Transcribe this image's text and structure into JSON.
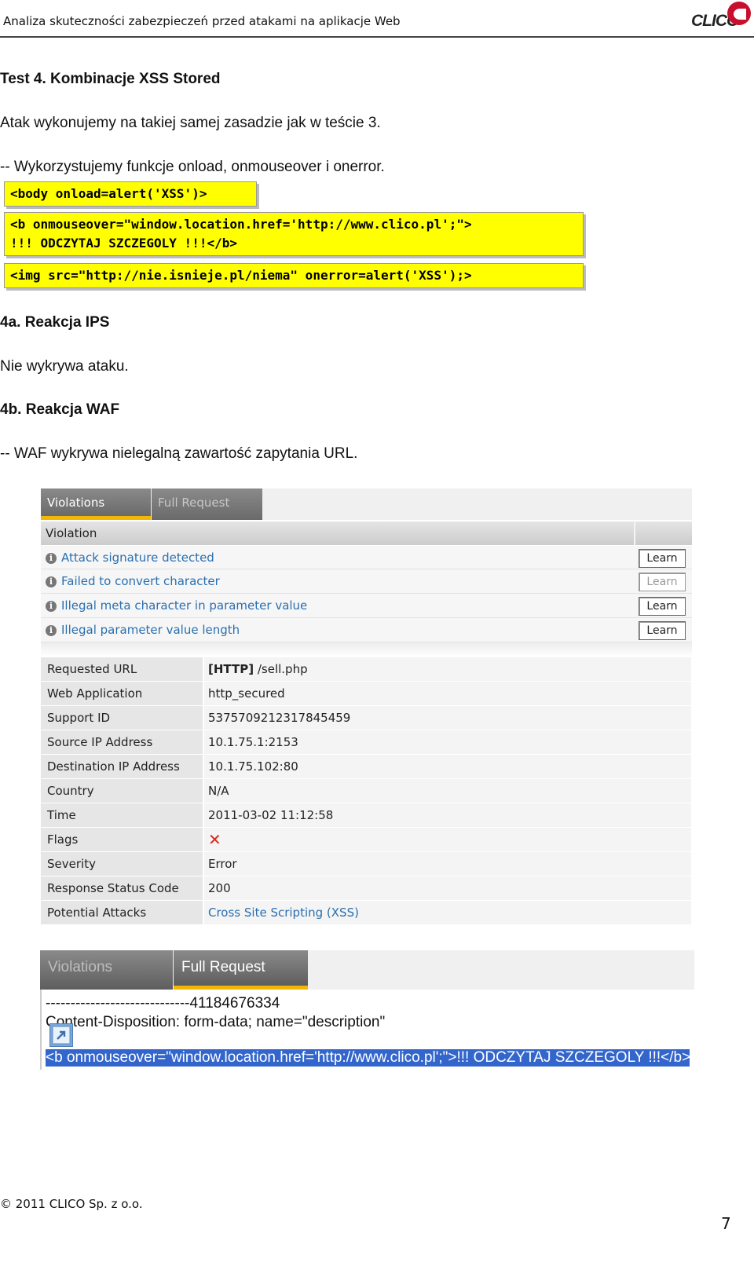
{
  "header": {
    "title": "Analiza skuteczności zabezpieczeń przed atakami na aplikacje Web",
    "logo_text": "CLICO"
  },
  "body": {
    "heading": "Test 4. Kombinacje XSS Stored",
    "para1": "Atak wykonujemy na takiej samej zasadzie jak w teście 3.",
    "para2": "-- Wykorzystujemy funkcje onload, onmouseover i onerror.",
    "code1": "<body onload=alert('XSS')>",
    "code2_line1": "<b onmouseover=\"window.location.href='http://www.clico.pl';\">",
    "code2_line2": "!!! ODCZYTAJ SZCZEGOLY !!!</b>",
    "code3": "<img src=\"http://nie.isnieje.pl/niema\" onerror=alert('XSS');>",
    "h_ips": "4a. Reakcja IPS",
    "ips_text": "Nie wykrywa ataku.",
    "h_waf": "4b. Reakcja WAF",
    "waf_text": "-- WAF wykrywa nielegalną zawartość zapytania URL."
  },
  "panel1": {
    "tabs": [
      "Violations",
      "Full Request"
    ],
    "violation_header": "Violation",
    "violations": [
      {
        "text": "Attack signature detected",
        "learn": "Learn",
        "enabled": true
      },
      {
        "text": "Failed to convert character",
        "learn": "Learn",
        "enabled": false
      },
      {
        "text": "Illegal meta character in parameter value",
        "learn": "Learn",
        "enabled": true
      },
      {
        "text": "Illegal parameter value length",
        "learn": "Learn",
        "enabled": true
      }
    ],
    "details": [
      {
        "label": "Requested URL",
        "prefix": "[HTTP]",
        "value": " /sell.php"
      },
      {
        "label": "Web Application",
        "value": "http_secured"
      },
      {
        "label": "Support ID",
        "value": "5375709212317845459"
      },
      {
        "label": "Source IP Address",
        "value": "10.1.75.1:2153"
      },
      {
        "label": "Destination IP Address",
        "value": "10.1.75.102:80"
      },
      {
        "label": "Country",
        "value": "N/A"
      },
      {
        "label": "Time",
        "value": "2011-03-02 11:12:58"
      },
      {
        "label": "Flags",
        "value": "✕"
      },
      {
        "label": "Severity",
        "value": "Error"
      },
      {
        "label": "Response Status Code",
        "value": "200"
      },
      {
        "label": "Potential Attacks",
        "value": "Cross Site Scripting (XSS)"
      }
    ]
  },
  "panel2": {
    "tabs": [
      "Violations",
      "Full Request"
    ],
    "line1": "-----------------------------41184676334",
    "line2": "Content-Disposition: form-data; name=\"description\"",
    "line3": "<b onmouseover=\"window.location.href='http://www.clico.pl';\">!!! ODCZYTAJ SZCZEGOLY !!!</b>"
  },
  "footer": {
    "copyright": "© 2011 CLICO Sp. z o.o.",
    "page": "7"
  },
  "colors": {
    "code_bg": "#ffff00",
    "link": "#2a6fb0",
    "tab_accent": "#f2b705",
    "selection": "#3366cc",
    "logo_red": "#c8102e"
  }
}
